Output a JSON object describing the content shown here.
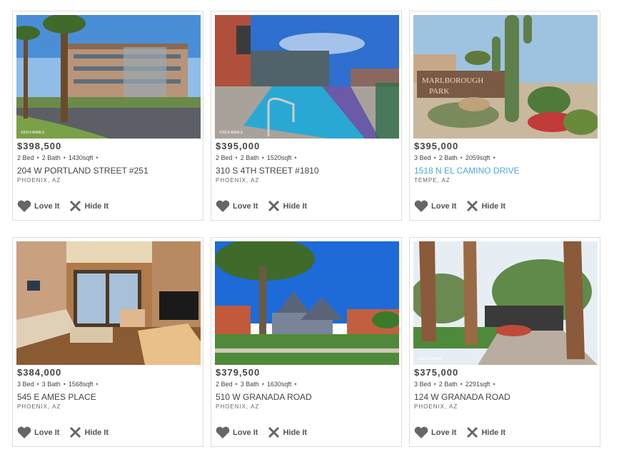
{
  "listings": [
    {
      "price": "$398,500",
      "beds": "2 Bed",
      "baths": "2 Bath",
      "sqft": "1430sqft",
      "address": "204 W PORTLAND STREET #251",
      "city": "PHOENIX, AZ",
      "love_label": "Love It",
      "hide_label": "Hide It"
    },
    {
      "price": "$395,000",
      "beds": "2 Bed",
      "baths": "2 Bath",
      "sqft": "1520sqft",
      "address": "310 S 4TH STREET #1810",
      "city": "PHOENIX, AZ",
      "love_label": "Love It",
      "hide_label": "Hide It"
    },
    {
      "price": "$395,000",
      "beds": "3 Bed",
      "baths": "2 Bath",
      "sqft": "2059sqft",
      "address": "1518 N EL CAMINO DRIVE",
      "city": "TEMPE, AZ",
      "love_label": "Love It",
      "hide_label": "Hide It",
      "sign_line1": "MARLBOROUGH",
      "sign_line2": "PARK"
    },
    {
      "price": "$384,000",
      "beds": "3 Bed",
      "baths": "3 Bath",
      "sqft": "1568sqft",
      "address": "545 E AMES PLACE",
      "city": "PHOENIX, AZ",
      "love_label": "Love It",
      "hide_label": "Hide It"
    },
    {
      "price": "$379,500",
      "beds": "2 Bed",
      "baths": "3 Bath",
      "sqft": "1630sqft",
      "address": "510 W GRANADA ROAD",
      "city": "PHOENIX, AZ",
      "love_label": "Love It",
      "hide_label": "Hide It"
    },
    {
      "price": "$375,000",
      "beds": "3 Bed",
      "baths": "2 Bath",
      "sqft": "2291sqft",
      "address": "124 W GRANADA ROAD",
      "city": "PHOENIX, AZ",
      "love_label": "Love It",
      "hide_label": "Hide It"
    }
  ],
  "colors": {
    "link": "#4aa8d8",
    "text": "#444444",
    "icon": "#666666",
    "border": "#dedede"
  }
}
